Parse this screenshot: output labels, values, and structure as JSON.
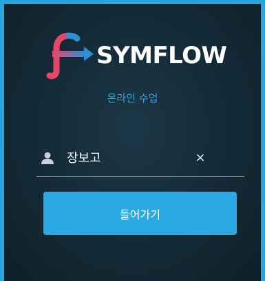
{
  "brand": {
    "name": "SYMFLOW",
    "logo_icon": "symflow-logo-icon"
  },
  "subtitle": "온라인 수업",
  "login": {
    "name_value": "장보고",
    "user_icon": "user-icon",
    "clear_icon": "close-icon",
    "clear_label": "×",
    "submit_label": "들어가기"
  },
  "colors": {
    "frame": "#2aa5dc",
    "background": "#132a36",
    "accent": "#2aa9e4",
    "subtitle": "#2fa6de",
    "logo_pink": "#e8456a",
    "logo_blue": "#2f8fd6"
  }
}
